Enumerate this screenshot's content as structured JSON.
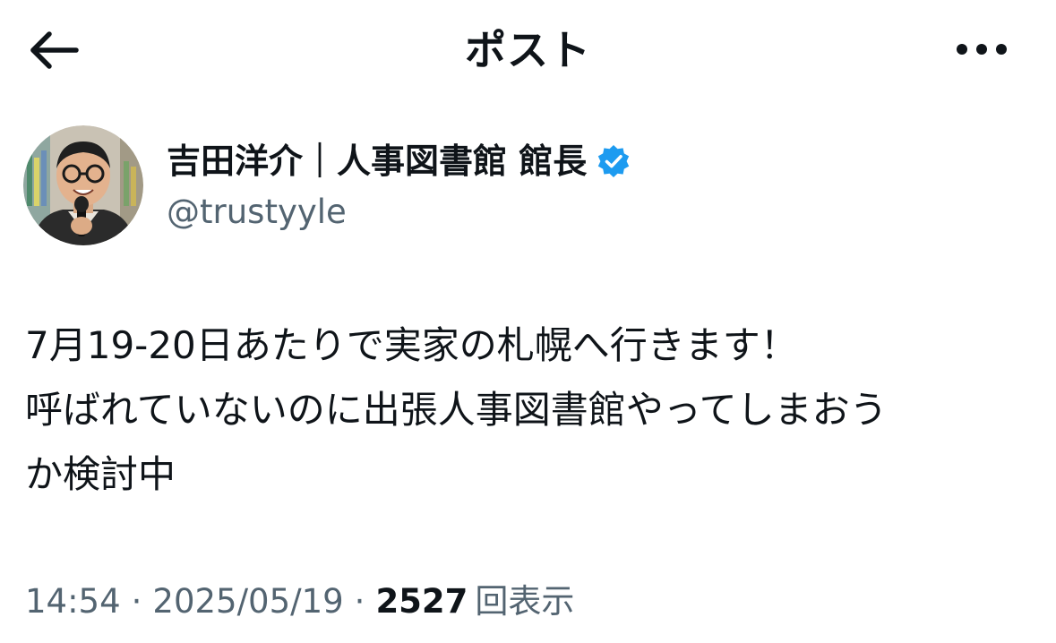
{
  "header": {
    "title": "ポスト",
    "back_icon": "arrow-left-icon",
    "more_icon": "more-horizontal-icon"
  },
  "author": {
    "display_name": "吉田洋介｜人事図書館 館長",
    "handle": "@trustyyle",
    "verified": true,
    "verified_color": "#1d9bf0"
  },
  "post": {
    "lines": [
      "7月19-20日あたりで実家の札幌へ行きます！",
      "呼ばれていないのに出張人事図書館やってしまおう",
      "か検討中"
    ]
  },
  "meta": {
    "time": "14:54",
    "date": "2025/05/19",
    "separator": "·",
    "views_count": "2527",
    "views_label": "回表示"
  },
  "colors": {
    "text_primary": "#0f1419",
    "text_secondary": "#536471",
    "background": "#ffffff"
  }
}
